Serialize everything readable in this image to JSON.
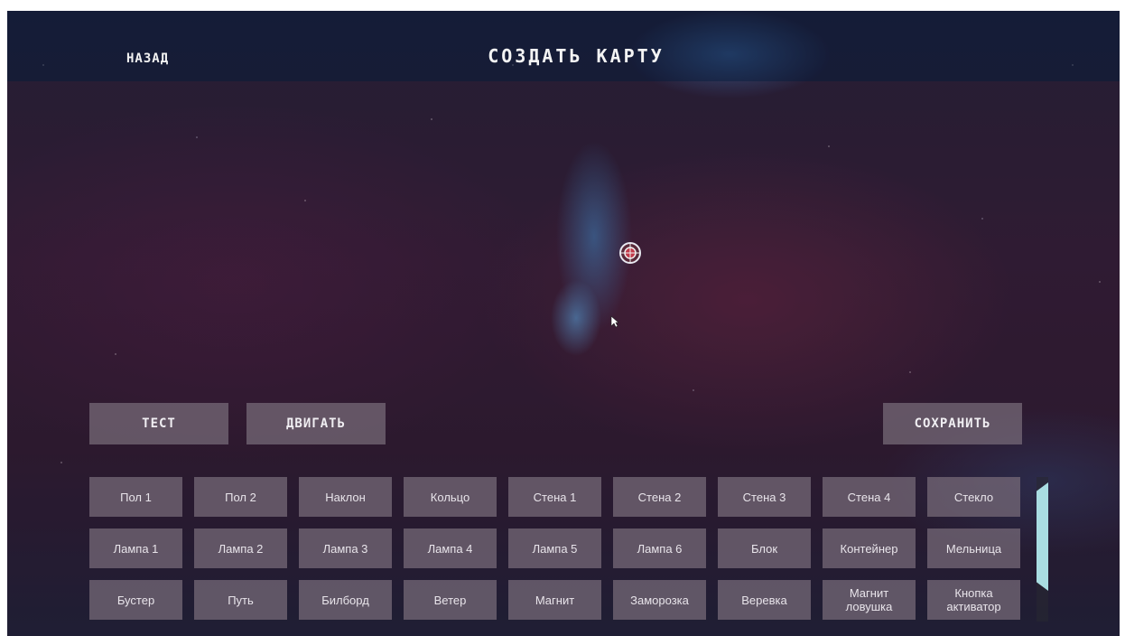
{
  "header": {
    "back_label": "НАЗАД",
    "title": "СОЗДАТЬ КАРТУ"
  },
  "actions": {
    "test_label": "ТЕСТ",
    "move_label": "ДВИГАТЬ",
    "save_label": "СОХРАНИТЬ"
  },
  "palette": {
    "rows": [
      [
        "Пол 1",
        "Пол 2",
        "Наклон",
        "Кольцо",
        "Стена 1",
        "Стена 2",
        "Стена 3",
        "Стена 4",
        "Стекло"
      ],
      [
        "Лампа 1",
        "Лампа 2",
        "Лампа 3",
        "Лампа 4",
        "Лампа 5",
        "Лампа 6",
        "Блок",
        "Контейнер",
        "Мельница"
      ],
      [
        "Бустер",
        "Путь",
        "Билборд",
        "Ветер",
        "Магнит",
        "Заморозка",
        "Веревка",
        "Магнит\nловушка",
        "Кнопка\nактиватор"
      ]
    ]
  },
  "icons": {
    "map_object": "ball-object-icon",
    "cursor": "mouse-cursor-icon"
  },
  "colors": {
    "button_bg": "#786c7a",
    "scroll_thumb": "#a9dde2",
    "text": "#f0eef2"
  }
}
